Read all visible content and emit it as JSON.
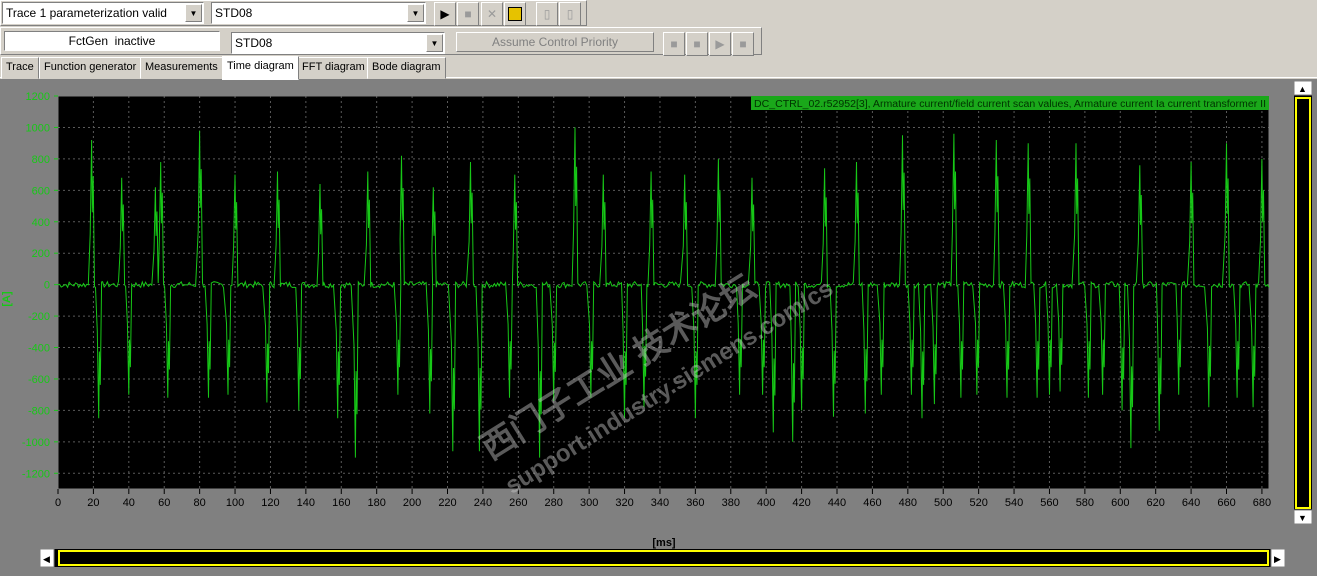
{
  "toolbar1": {
    "trace_status": "Trace 1 parameterization valid",
    "device_select": "STD08",
    "buttons": [
      {
        "name": "start-trace-button",
        "icon": "play-icon",
        "enabled": true
      },
      {
        "name": "stop-trace-button",
        "icon": "stop-icon",
        "enabled": false
      },
      {
        "name": "delete-trace-button",
        "icon": "delete-icon",
        "enabled": false
      },
      {
        "name": "save-trace-button",
        "icon": "save-icon",
        "enabled": true
      },
      {
        "name": "trace-option-1-button",
        "icon": "device-icon",
        "enabled": false
      },
      {
        "name": "trace-option-2-button",
        "icon": "device-icon",
        "enabled": false
      }
    ]
  },
  "toolbar2": {
    "fctgen_status": "FctGen  inactive",
    "device_select": "STD08",
    "priority_button": "Assume Control Priority"
  },
  "tabs": [
    {
      "label": "Trace",
      "active": false
    },
    {
      "label": "Function generator",
      "active": false
    },
    {
      "label": "Measurements",
      "active": false
    },
    {
      "label": "Time diagram",
      "active": true
    },
    {
      "label": "FFT diagram",
      "active": false
    },
    {
      "label": "Bode diagram",
      "active": false
    }
  ],
  "watermark": {
    "line1": "西门子工业 技术论坛",
    "line2": "support.industry.siemens.com/cs"
  },
  "chart_data": {
    "type": "line",
    "title": "",
    "legend": "DC_CTRL_02.r52952[3], Armature current/field current scan values, Armature current Ia current transformer II",
    "legend_position": "top-right",
    "xlabel": "[ms]",
    "ylabel": "[A]",
    "xlim": [
      0,
      684
    ],
    "ylim": [
      -1300,
      1200
    ],
    "x_ticks": [
      0,
      20,
      40,
      60,
      80,
      100,
      120,
      140,
      160,
      180,
      200,
      220,
      240,
      260,
      280,
      300,
      320,
      340,
      360,
      380,
      400,
      420,
      440,
      460,
      480,
      500,
      520,
      540,
      560,
      580,
      600,
      620,
      640,
      660,
      680
    ],
    "y_ticks": [
      1200,
      1000,
      800,
      600,
      400,
      200,
      0,
      -200,
      -400,
      -600,
      -800,
      -1000,
      -1200
    ],
    "grid": true,
    "colors": {
      "background": "#000000",
      "trace": "#17c817",
      "grid": "#5a5a5a",
      "axis_text": "#17c817",
      "frame": "#808080"
    },
    "series": [
      {
        "name": "DC_CTRL_02.r52952[3]",
        "peaks": [
          [
            19,
            920
          ],
          [
            23,
            -850
          ],
          [
            36,
            680
          ],
          [
            40,
            -700
          ],
          [
            55,
            620
          ],
          [
            62,
            -720
          ],
          [
            58,
            780
          ],
          [
            80,
            980
          ],
          [
            85,
            -720
          ],
          [
            96,
            -700
          ],
          [
            100,
            700
          ],
          [
            118,
            -750
          ],
          [
            124,
            720
          ],
          [
            136,
            -800
          ],
          [
            148,
            640
          ],
          [
            158,
            -850
          ],
          [
            168,
            -1100
          ],
          [
            175,
            720
          ],
          [
            192,
            -700
          ],
          [
            194,
            820
          ],
          [
            210,
            -820
          ],
          [
            212,
            620
          ],
          [
            223,
            -1060
          ],
          [
            233,
            780
          ],
          [
            238,
            -1060
          ],
          [
            255,
            -720
          ],
          [
            258,
            700
          ],
          [
            272,
            -1100
          ],
          [
            280,
            -740
          ],
          [
            292,
            1000
          ],
          [
            301,
            -720
          ],
          [
            308,
            700
          ],
          [
            320,
            -850
          ],
          [
            331,
            -780
          ],
          [
            335,
            720
          ],
          [
            354,
            700
          ],
          [
            360,
            -850
          ],
          [
            373,
            800
          ],
          [
            385,
            -700
          ],
          [
            392,
            680
          ],
          [
            398,
            -700
          ],
          [
            404,
            -940
          ],
          [
            415,
            -1000
          ],
          [
            420,
            -800
          ],
          [
            433,
            740
          ],
          [
            438,
            -840
          ],
          [
            451,
            780
          ],
          [
            456,
            -820
          ],
          [
            465,
            -700
          ],
          [
            477,
            950
          ],
          [
            482,
            -700
          ],
          [
            488,
            -850
          ],
          [
            495,
            -760
          ],
          [
            506,
            960
          ],
          [
            510,
            -720
          ],
          [
            519,
            -700
          ],
          [
            530,
            920
          ],
          [
            536,
            -720
          ],
          [
            548,
            900
          ],
          [
            553,
            -720
          ],
          [
            560,
            -700
          ],
          [
            566,
            -680
          ],
          [
            575,
            900
          ],
          [
            582,
            -720
          ],
          [
            590,
            -700
          ],
          [
            601,
            -800
          ],
          [
            606,
            -1040
          ],
          [
            611,
            760
          ],
          [
            622,
            -930
          ],
          [
            633,
            -700
          ],
          [
            640,
            780
          ],
          [
            650,
            -780
          ],
          [
            660,
            900
          ],
          [
            666,
            -720
          ],
          [
            675,
            -780
          ],
          [
            680,
            800
          ]
        ]
      }
    ]
  }
}
